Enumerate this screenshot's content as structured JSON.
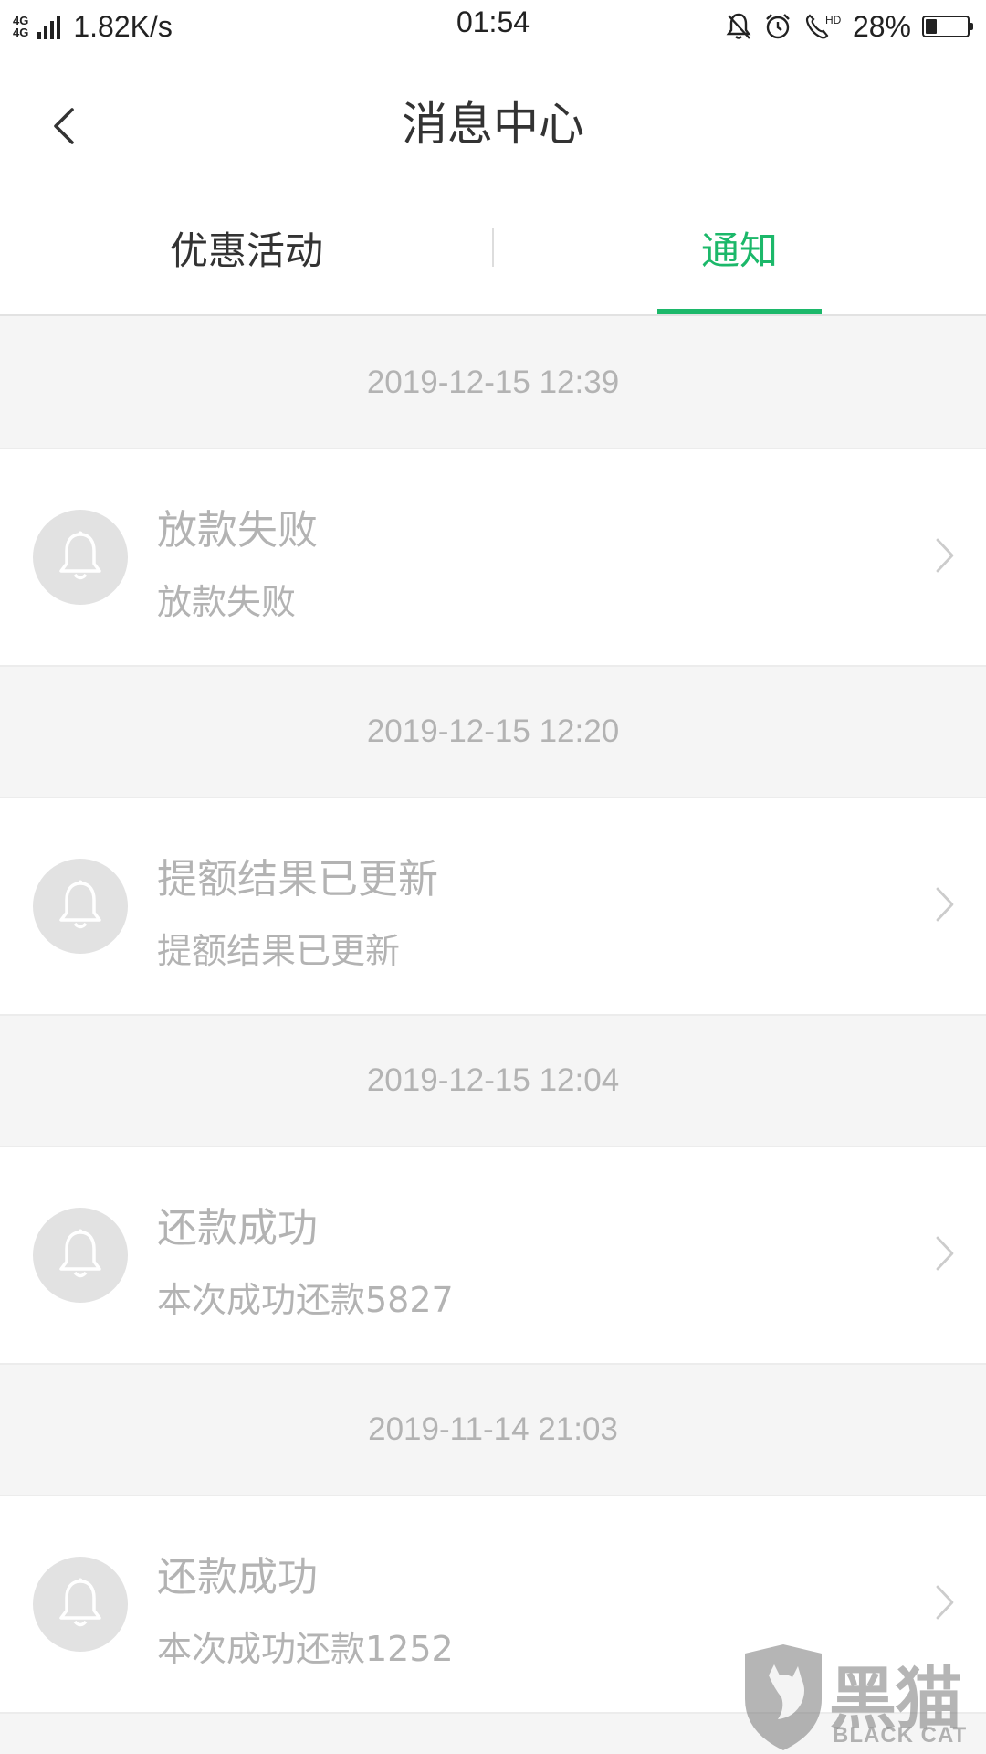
{
  "status_bar": {
    "net_label_1": "4G",
    "net_label_2": "4G",
    "net_speed": "1.82K/s",
    "time": "01:54",
    "battery_percent": "28%",
    "battery_level": 0.28,
    "icons": [
      "signal-icon",
      "bell-off-icon",
      "alarm-icon",
      "hd-call-icon",
      "battery-icon"
    ]
  },
  "header": {
    "title": "消息中心",
    "back_icon": "chevron-left-icon"
  },
  "tabs": [
    {
      "label": "优惠活动",
      "active": false
    },
    {
      "label": "通知",
      "active": true
    }
  ],
  "colors": {
    "accent": "#1cb86a",
    "muted_text": "#b3b3b3",
    "background": "#f5f5f5",
    "card": "#ffffff"
  },
  "messages": [
    {
      "time": "2019-12-15 12:39",
      "title": "放款失败",
      "body": "放款失败",
      "icon": "bell-icon"
    },
    {
      "time": "2019-12-15 12:20",
      "title": "提额结果已更新",
      "body": "提额结果已更新",
      "icon": "bell-icon"
    },
    {
      "time": "2019-12-15 12:04",
      "title": "还款成功",
      "body": "本次成功还款5827",
      "icon": "bell-icon"
    },
    {
      "time": "2019-11-14 21:03",
      "title": "还款成功",
      "body": "本次成功还款1252",
      "icon": "bell-icon"
    }
  ],
  "watermark": {
    "text_cn": "黑猫",
    "text_en": "BLACK CAT"
  }
}
